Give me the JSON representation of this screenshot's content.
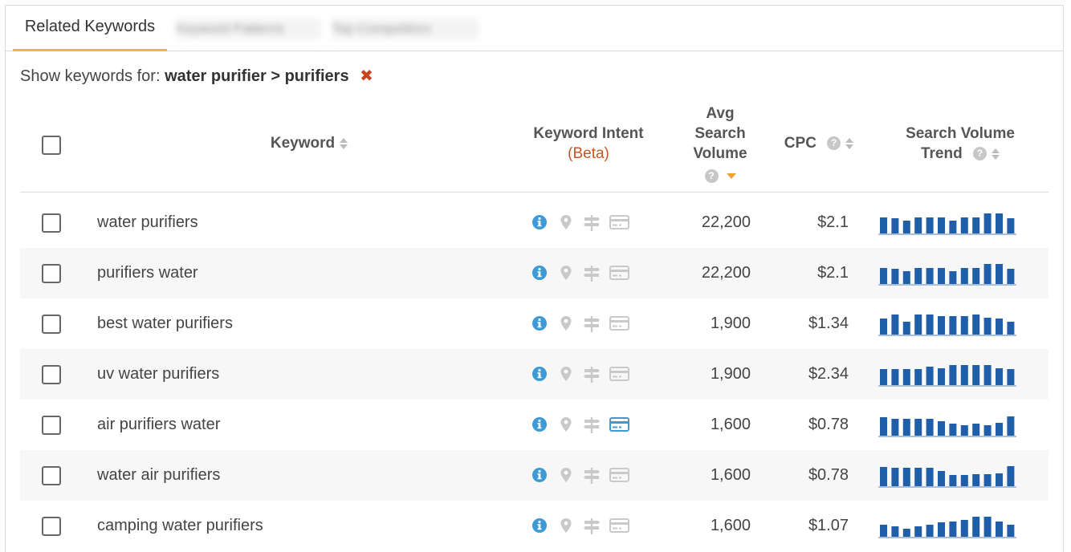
{
  "tabs": [
    "Related Keywords",
    "Keyword Patterns",
    "Top Competitors"
  ],
  "filter": {
    "prefix": "Show keywords for:",
    "path": "water purifier > purifiers",
    "clear_icon": "close-icon"
  },
  "header": {
    "keyword": "Keyword",
    "intent": "Keyword Intent",
    "intent_beta": "(Beta)",
    "volume": [
      "Avg",
      "Search",
      "Volume"
    ],
    "cpc": "CPC",
    "trend": [
      "Search Volume",
      "Trend"
    ]
  },
  "colors": {
    "accent": "#f0b34a",
    "trend_bar": "#1f5ea8",
    "info": "#3d9ad6",
    "commercial": "#3d9ad6",
    "clear": "#c8421e"
  },
  "rows": [
    {
      "keyword": "water purifiers",
      "volume": "22,200",
      "cpc": "$2.1",
      "commercial": false,
      "trend": [
        0.8,
        0.75,
        0.65,
        0.8,
        0.8,
        0.8,
        0.65,
        0.8,
        0.8,
        1.0,
        1.0,
        0.75
      ]
    },
    {
      "keyword": "purifiers water",
      "volume": "22,200",
      "cpc": "$2.1",
      "commercial": false,
      "trend": [
        0.8,
        0.75,
        0.65,
        0.8,
        0.8,
        0.8,
        0.65,
        0.8,
        0.8,
        1.0,
        1.0,
        0.75
      ]
    },
    {
      "keyword": "best water purifiers",
      "volume": "1,900",
      "cpc": "$1.34",
      "commercial": false,
      "trend": [
        0.8,
        1.0,
        0.65,
        1.0,
        1.0,
        0.9,
        0.9,
        0.9,
        1.0,
        0.85,
        0.8,
        0.65
      ]
    },
    {
      "keyword": "uv water purifiers",
      "volume": "1,900",
      "cpc": "$2.34",
      "commercial": false,
      "trend": [
        0.8,
        0.8,
        0.8,
        0.8,
        0.9,
        0.85,
        1.0,
        1.0,
        1.0,
        1.0,
        0.85,
        0.8
      ]
    },
    {
      "keyword": "air purifiers water",
      "volume": "1,600",
      "cpc": "$0.78",
      "commercial": true,
      "trend": [
        0.9,
        0.85,
        0.85,
        0.85,
        0.85,
        0.7,
        0.6,
        0.5,
        0.6,
        0.5,
        0.65,
        0.95
      ]
    },
    {
      "keyword": "water air purifiers",
      "volume": "1,600",
      "cpc": "$0.78",
      "commercial": false,
      "trend": [
        0.95,
        0.9,
        0.9,
        0.9,
        0.9,
        0.75,
        0.55,
        0.55,
        0.6,
        0.6,
        0.65,
        1.0
      ]
    },
    {
      "keyword": "camping water purifiers",
      "volume": "1,600",
      "cpc": "$1.07",
      "commercial": false,
      "trend": [
        0.6,
        0.5,
        0.4,
        0.5,
        0.6,
        0.7,
        0.75,
        0.85,
        1.0,
        1.0,
        0.75,
        0.6
      ]
    }
  ]
}
